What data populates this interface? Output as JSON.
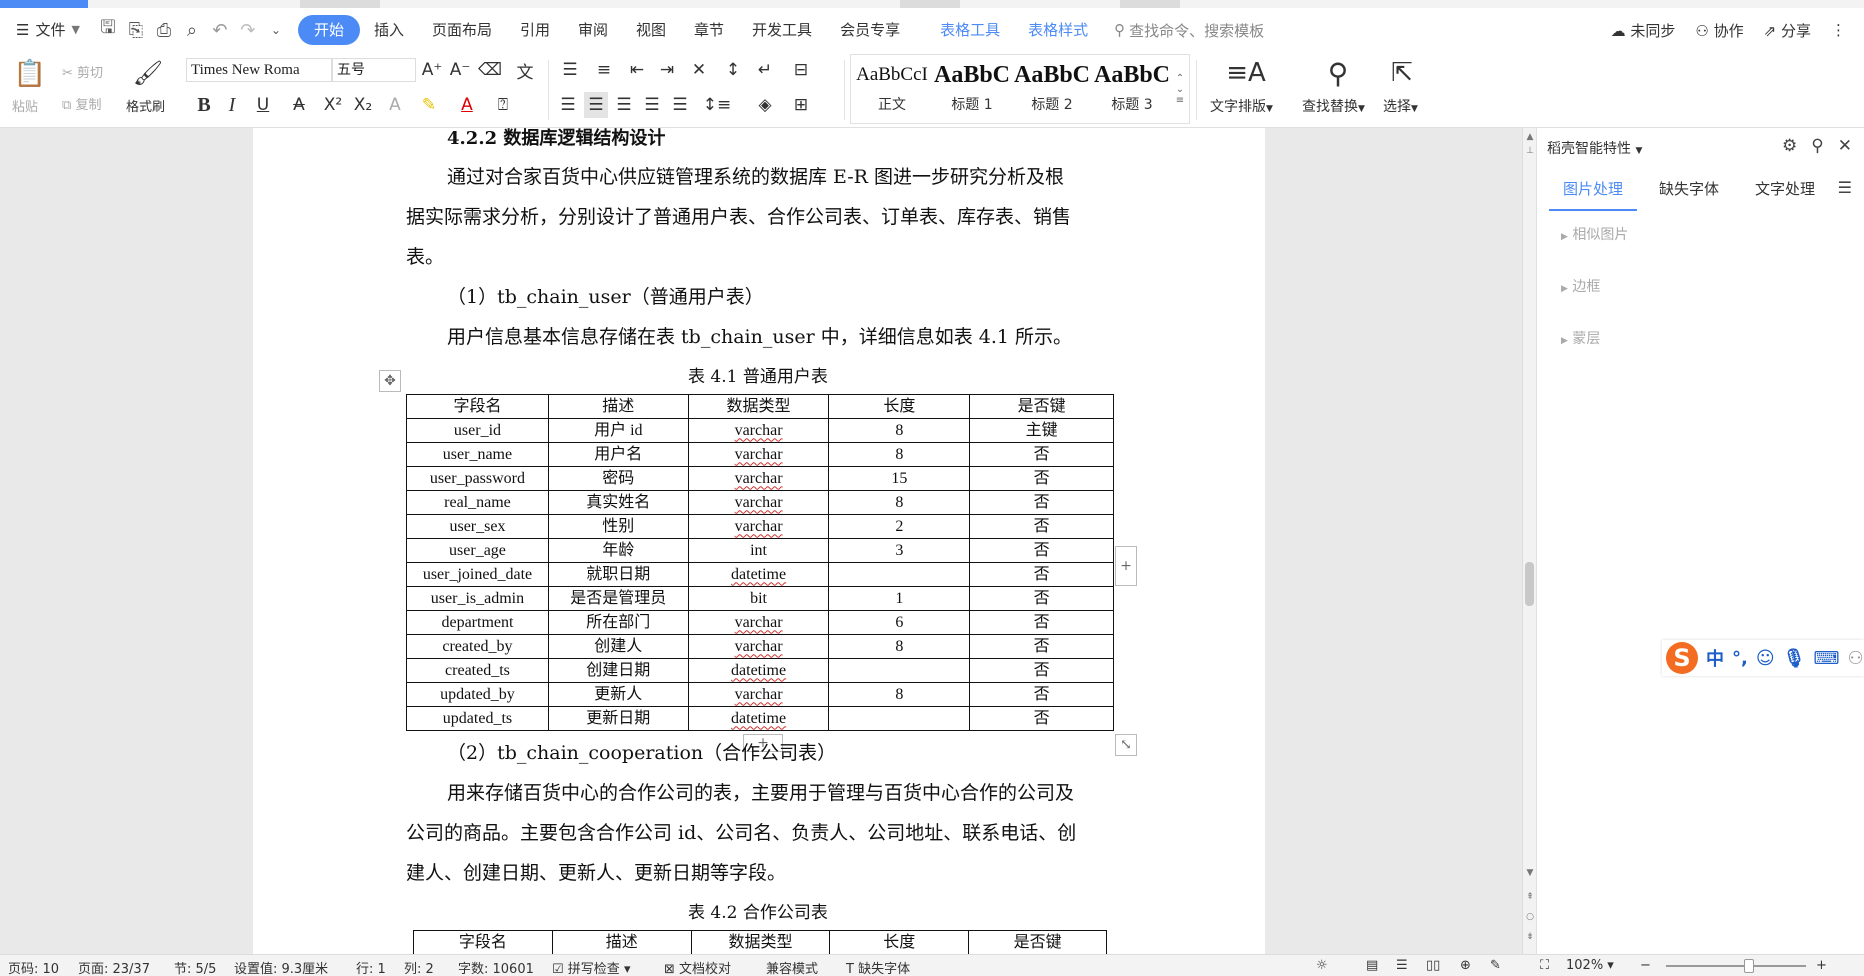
{
  "menubar": {
    "file_label": "文件",
    "tabs": [
      "开始",
      "插入",
      "页面布局",
      "引用",
      "审阅",
      "视图",
      "章节",
      "开发工具",
      "会员专享"
    ],
    "context_tabs": [
      "表格工具",
      "表格样式"
    ],
    "search_placeholder": "查找命令、搜索模板",
    "right": {
      "sync": "未同步",
      "collab": "协作",
      "share": "分享"
    }
  },
  "ribbon": {
    "paste": "粘贴",
    "cut": "剪切",
    "copy": "复制",
    "format_painter": "格式刷",
    "font_name": "Times New Roma",
    "font_size": "五号",
    "styles": [
      {
        "preview": "AaBbCcI",
        "label": "正文"
      },
      {
        "preview": "AaBbC",
        "label": "标题 1"
      },
      {
        "preview": "AaBbC",
        "label": "标题 2"
      },
      {
        "preview": "AaBbC",
        "label": "标题 3"
      }
    ],
    "text_layout": "文字排版",
    "find_replace": "查找替换",
    "select": "选择"
  },
  "document": {
    "heading": "4.2.2  数据库逻辑结构设计",
    "para1": [
      "通过对合家百货中心供应链管理系统的数据库 E-R 图进一步研究分析及根",
      "据实际需求分析，分别设计了普通用户表、合作公司表、订单表、库存表、销售",
      "表。"
    ],
    "item1": "（1）tb_chain_user（普通用户表）",
    "para2": "用户信息基本信息存储在表 tb_chain_user 中，详细信息如表 4.1 所示。",
    "table1_caption": "表 4.1  普通用户表",
    "table_headers": [
      "字段名",
      "描述",
      "数据类型",
      "长度",
      "是否键"
    ],
    "table1_rows": [
      [
        "user_id",
        "用户 id",
        "varchar",
        "8",
        "主键"
      ],
      [
        "user_name",
        "用户名",
        "varchar",
        "8",
        "否"
      ],
      [
        "user_password",
        "密码",
        "varchar",
        "15",
        "否"
      ],
      [
        "real_name",
        "真实姓名",
        "varchar",
        "8",
        "否"
      ],
      [
        "user_sex",
        "性别",
        "varchar",
        "2",
        "否"
      ],
      [
        "user_age",
        "年龄",
        "int",
        "3",
        "否"
      ],
      [
        "user_joined_date",
        "就职日期",
        "datetime",
        "",
        "否"
      ],
      [
        "user_is_admin",
        "是否是管理员",
        "bit",
        "1",
        "否"
      ],
      [
        "department",
        "所在部门",
        "varchar",
        "6",
        "否"
      ],
      [
        "created_by",
        "创建人",
        "varchar",
        "8",
        "否"
      ],
      [
        "created_ts",
        "创建日期",
        "datetime",
        "",
        "否"
      ],
      [
        "updated_by",
        "更新人",
        "varchar",
        "8",
        "否"
      ],
      [
        "updated_ts",
        "更新日期",
        "datetime",
        "",
        "否"
      ]
    ],
    "item2": "（2）tb_chain_cooperation（合作公司表）",
    "para3": [
      "用来存储百货中心的合作公司的表，主要用于管理与百货中心合作的公司及",
      "公司的商品。主要包含合作公司 id、公司名、负责人、公司地址、联系电话、创",
      "建人、创建日期、更新人、更新日期等字段。"
    ],
    "table2_caption": "表 4.2  合作公司表"
  },
  "right_panel": {
    "title": "稻壳智能特性",
    "tabs": [
      "图片处理",
      "缺失字体",
      "文字处理"
    ],
    "sections": [
      "相似图片",
      "边框",
      "蒙层"
    ]
  },
  "ime": {
    "lang": "中"
  },
  "statusbar": {
    "page": "页码: 10",
    "pages": "页面: 23/37",
    "section": "节: 5/5",
    "setting": "设置值: 9.3厘米",
    "row": "行: 1",
    "col": "列: 2",
    "words": "字数: 10601",
    "spell": "拼写检查",
    "proof": "文档校对",
    "compat": "兼容模式",
    "missing_font": "缺失字体",
    "zoom": "102%"
  },
  "colors": {
    "accent": "#4c8bf5",
    "ime_orange": "#f36c21"
  }
}
